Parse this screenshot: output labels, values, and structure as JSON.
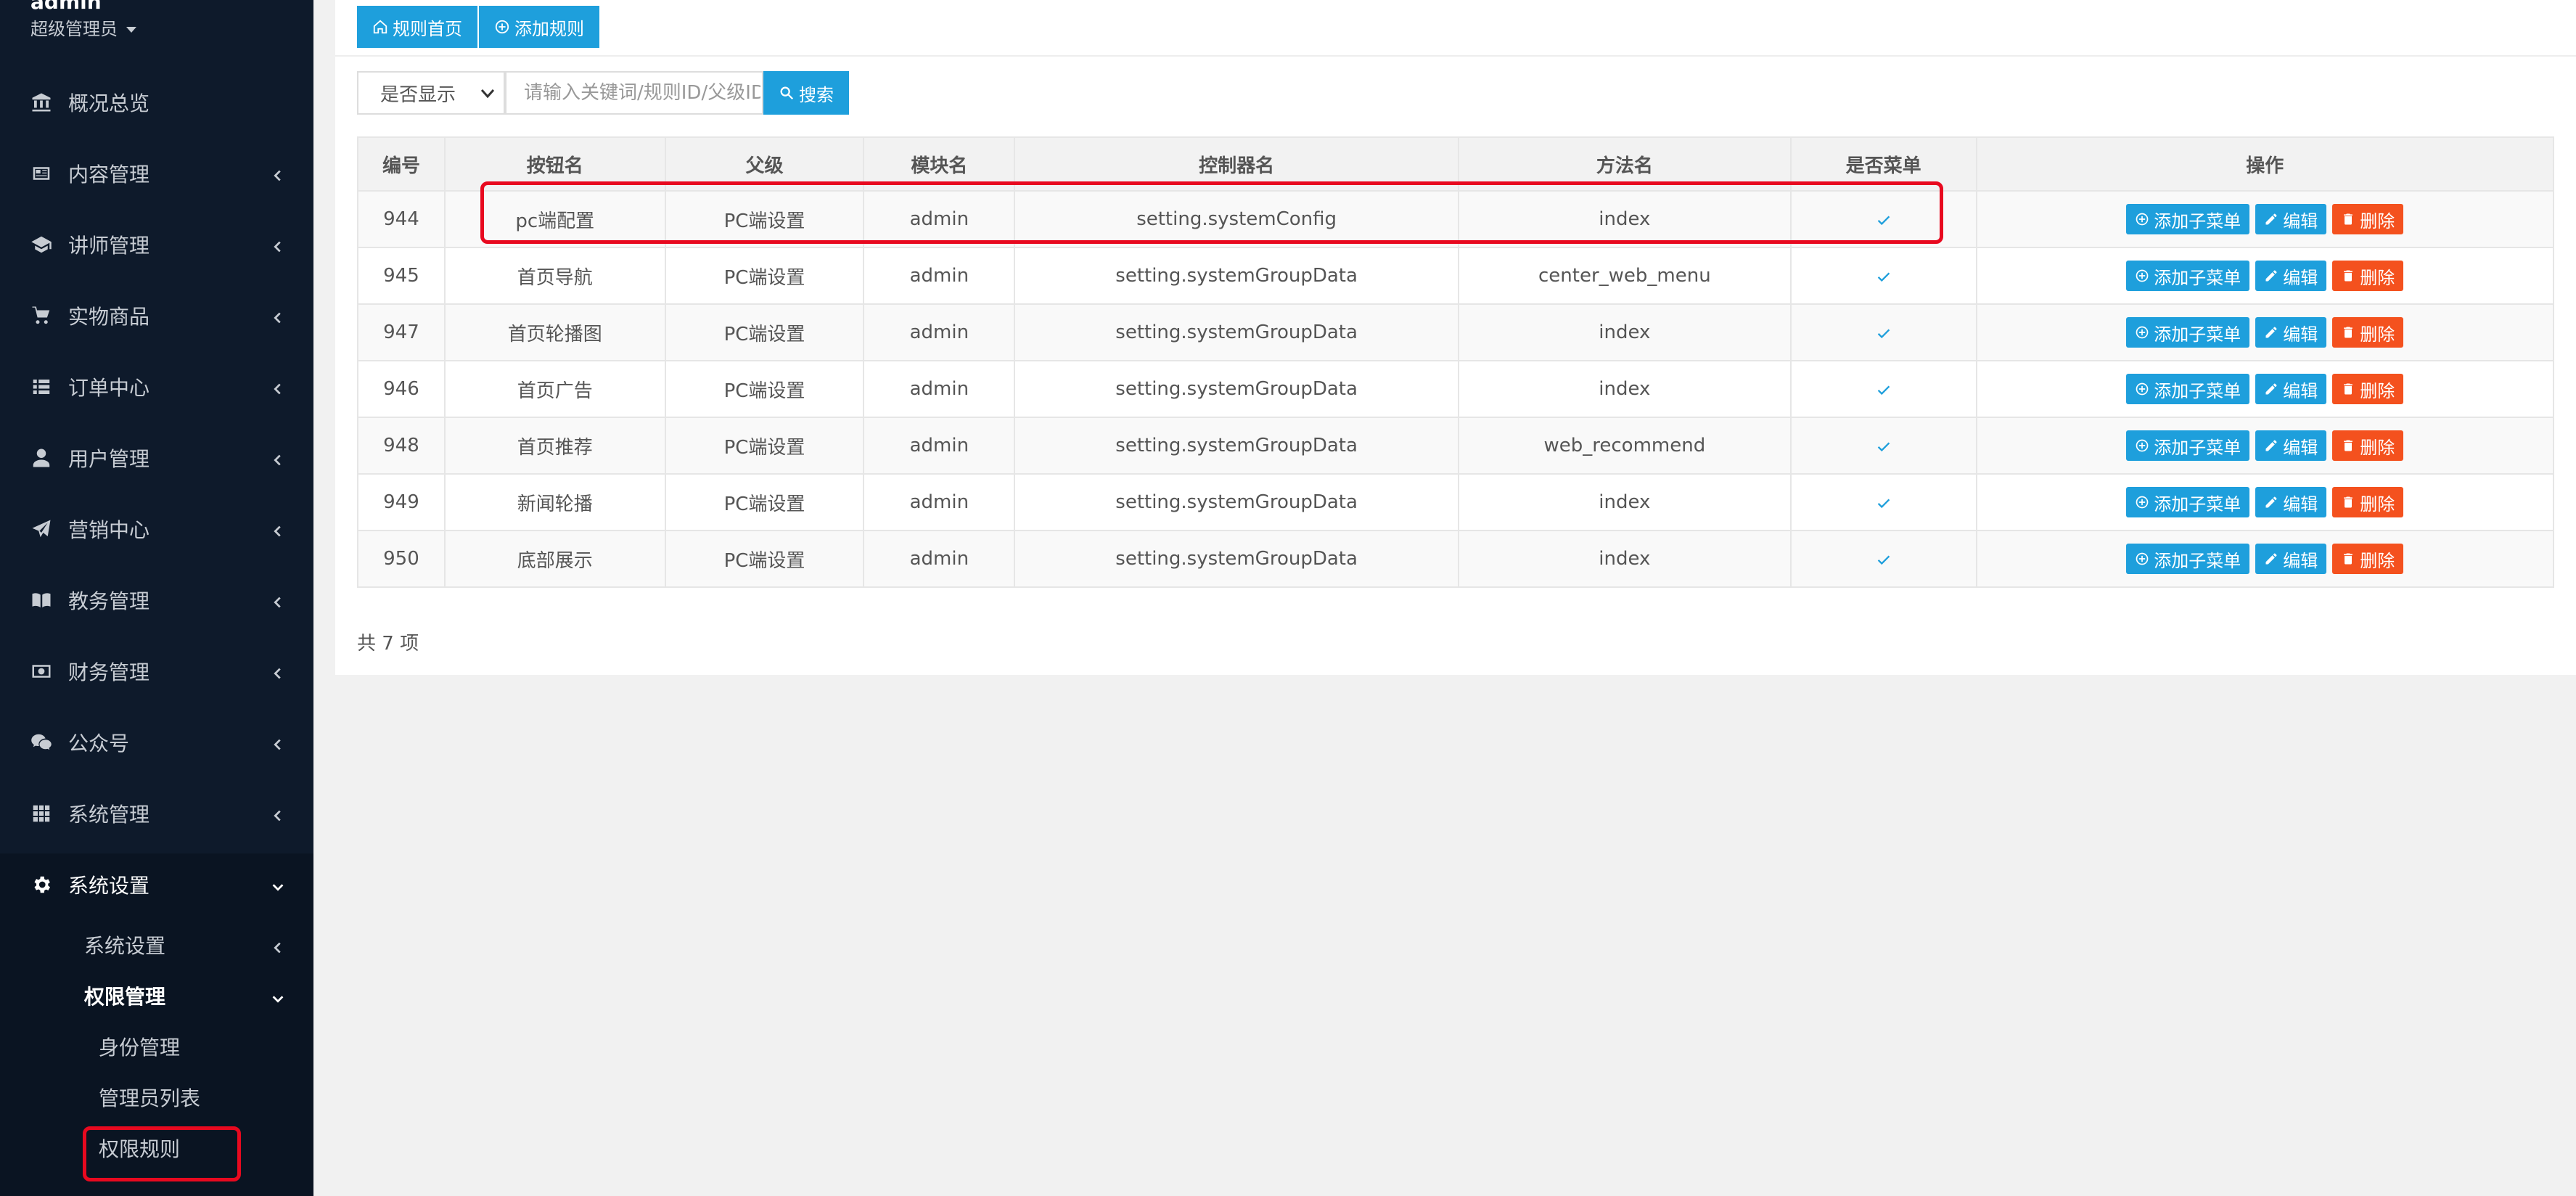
{
  "sidebar": {
    "user": {
      "name": "admin",
      "role": "超级管理员"
    },
    "items": [
      {
        "label": "概况总览",
        "icon": "bank-icon",
        "has_chevron": false
      },
      {
        "label": "内容管理",
        "icon": "newspaper-icon",
        "has_chevron": true
      },
      {
        "label": "讲师管理",
        "icon": "graduation-cap-icon",
        "has_chevron": true
      },
      {
        "label": "实物商品",
        "icon": "cart-icon",
        "has_chevron": true
      },
      {
        "label": "订单中心",
        "icon": "list-icon",
        "has_chevron": true
      },
      {
        "label": "用户管理",
        "icon": "user-icon",
        "has_chevron": true
      },
      {
        "label": "营销中心",
        "icon": "paper-plane-icon",
        "has_chevron": true
      },
      {
        "label": "教务管理",
        "icon": "book-icon",
        "has_chevron": true
      },
      {
        "label": "财务管理",
        "icon": "money-icon",
        "has_chevron": true
      },
      {
        "label": "公众号",
        "icon": "wechat-icon",
        "has_chevron": true
      },
      {
        "label": "系统管理",
        "icon": "grid-icon",
        "has_chevron": true
      },
      {
        "label": "系统设置",
        "icon": "gear-icon",
        "has_chevron": true
      }
    ],
    "sub_items": [
      {
        "label": "系统设置"
      },
      {
        "label": "权限管理"
      },
      {
        "label": "身份管理"
      },
      {
        "label": "管理员列表"
      },
      {
        "label": "权限规则"
      }
    ]
  },
  "toolbar": {
    "home_label": "规则首页",
    "add_label": "添加规则"
  },
  "filter": {
    "select_value": "是否显示",
    "search_placeholder": "请输入关键词/规则ID/父级ID",
    "search_label": "搜索"
  },
  "table": {
    "headers": [
      "编号",
      "按钮名",
      "父级",
      "模块名",
      "控制器名",
      "方法名",
      "是否菜单",
      "操作"
    ],
    "rows": [
      {
        "id": "944",
        "name": "pc端配置",
        "parent": "PC端设置",
        "module": "admin",
        "controller": "setting.systemConfig",
        "method": "index"
      },
      {
        "id": "945",
        "name": "首页导航",
        "parent": "PC端设置",
        "module": "admin",
        "controller": "setting.systemGroupData",
        "method": "center_web_menu"
      },
      {
        "id": "947",
        "name": "首页轮播图",
        "parent": "PC端设置",
        "module": "admin",
        "controller": "setting.systemGroupData",
        "method": "index"
      },
      {
        "id": "946",
        "name": "首页广告",
        "parent": "PC端设置",
        "module": "admin",
        "controller": "setting.systemGroupData",
        "method": "index"
      },
      {
        "id": "948",
        "name": "首页推荐",
        "parent": "PC端设置",
        "module": "admin",
        "controller": "setting.systemGroupData",
        "method": "web_recommend"
      },
      {
        "id": "949",
        "name": "新闻轮播",
        "parent": "PC端设置",
        "module": "admin",
        "controller": "setting.systemGroupData",
        "method": "index"
      },
      {
        "id": "950",
        "name": "底部展示",
        "parent": "PC端设置",
        "module": "admin",
        "controller": "setting.systemGroupData",
        "method": "index"
      }
    ],
    "actions": {
      "add_child": "添加子菜单",
      "edit": "编辑",
      "delete": "删除"
    }
  },
  "pagination": {
    "total_text": "共 7 项"
  },
  "colors": {
    "accent": "#1e9fdc",
    "danger": "#f4511e",
    "highlight": "#e8091f",
    "sidebar_bg": "#0e1a2b"
  }
}
